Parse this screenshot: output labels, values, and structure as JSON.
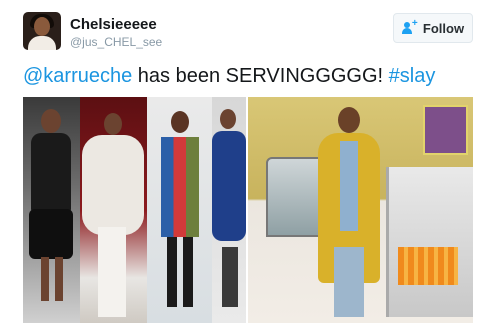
{
  "user": {
    "display_name": "Chelsieeeee",
    "handle": "@jus_CHEL_see"
  },
  "follow_button": {
    "label": "Follow",
    "icon": "add-person-icon"
  },
  "tweet": {
    "mention": "@karrueche",
    "text": " has been SERVINGGGGG! ",
    "hashtag": "#slay"
  },
  "colors": {
    "link": "#1b95e0",
    "follow_accent": "#1da1f2",
    "name": "#14171a",
    "handle": "#8899a6"
  }
}
